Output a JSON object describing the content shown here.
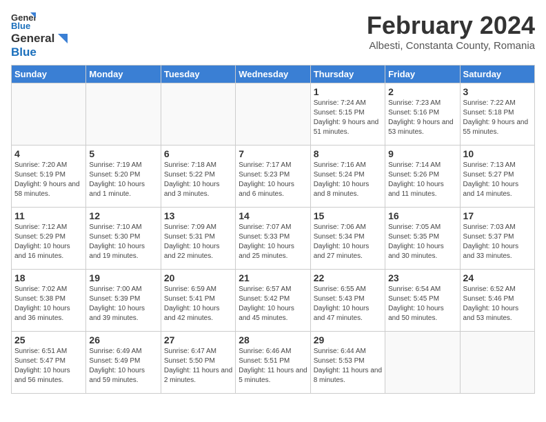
{
  "header": {
    "logo_general": "General",
    "logo_blue": "Blue",
    "month_title": "February 2024",
    "location": "Albesti, Constanta County, Romania"
  },
  "calendar": {
    "days_of_week": [
      "Sunday",
      "Monday",
      "Tuesday",
      "Wednesday",
      "Thursday",
      "Friday",
      "Saturday"
    ],
    "weeks": [
      [
        {
          "day": "",
          "info": ""
        },
        {
          "day": "",
          "info": ""
        },
        {
          "day": "",
          "info": ""
        },
        {
          "day": "",
          "info": ""
        },
        {
          "day": "1",
          "info": "Sunrise: 7:24 AM\nSunset: 5:15 PM\nDaylight: 9 hours\nand 51 minutes."
        },
        {
          "day": "2",
          "info": "Sunrise: 7:23 AM\nSunset: 5:16 PM\nDaylight: 9 hours\nand 53 minutes."
        },
        {
          "day": "3",
          "info": "Sunrise: 7:22 AM\nSunset: 5:18 PM\nDaylight: 9 hours\nand 55 minutes."
        }
      ],
      [
        {
          "day": "4",
          "info": "Sunrise: 7:20 AM\nSunset: 5:19 PM\nDaylight: 9 hours\nand 58 minutes."
        },
        {
          "day": "5",
          "info": "Sunrise: 7:19 AM\nSunset: 5:20 PM\nDaylight: 10 hours\nand 1 minute."
        },
        {
          "day": "6",
          "info": "Sunrise: 7:18 AM\nSunset: 5:22 PM\nDaylight: 10 hours\nand 3 minutes."
        },
        {
          "day": "7",
          "info": "Sunrise: 7:17 AM\nSunset: 5:23 PM\nDaylight: 10 hours\nand 6 minutes."
        },
        {
          "day": "8",
          "info": "Sunrise: 7:16 AM\nSunset: 5:24 PM\nDaylight: 10 hours\nand 8 minutes."
        },
        {
          "day": "9",
          "info": "Sunrise: 7:14 AM\nSunset: 5:26 PM\nDaylight: 10 hours\nand 11 minutes."
        },
        {
          "day": "10",
          "info": "Sunrise: 7:13 AM\nSunset: 5:27 PM\nDaylight: 10 hours\nand 14 minutes."
        }
      ],
      [
        {
          "day": "11",
          "info": "Sunrise: 7:12 AM\nSunset: 5:29 PM\nDaylight: 10 hours\nand 16 minutes."
        },
        {
          "day": "12",
          "info": "Sunrise: 7:10 AM\nSunset: 5:30 PM\nDaylight: 10 hours\nand 19 minutes."
        },
        {
          "day": "13",
          "info": "Sunrise: 7:09 AM\nSunset: 5:31 PM\nDaylight: 10 hours\nand 22 minutes."
        },
        {
          "day": "14",
          "info": "Sunrise: 7:07 AM\nSunset: 5:33 PM\nDaylight: 10 hours\nand 25 minutes."
        },
        {
          "day": "15",
          "info": "Sunrise: 7:06 AM\nSunset: 5:34 PM\nDaylight: 10 hours\nand 27 minutes."
        },
        {
          "day": "16",
          "info": "Sunrise: 7:05 AM\nSunset: 5:35 PM\nDaylight: 10 hours\nand 30 minutes."
        },
        {
          "day": "17",
          "info": "Sunrise: 7:03 AM\nSunset: 5:37 PM\nDaylight: 10 hours\nand 33 minutes."
        }
      ],
      [
        {
          "day": "18",
          "info": "Sunrise: 7:02 AM\nSunset: 5:38 PM\nDaylight: 10 hours\nand 36 minutes."
        },
        {
          "day": "19",
          "info": "Sunrise: 7:00 AM\nSunset: 5:39 PM\nDaylight: 10 hours\nand 39 minutes."
        },
        {
          "day": "20",
          "info": "Sunrise: 6:59 AM\nSunset: 5:41 PM\nDaylight: 10 hours\nand 42 minutes."
        },
        {
          "day": "21",
          "info": "Sunrise: 6:57 AM\nSunset: 5:42 PM\nDaylight: 10 hours\nand 45 minutes."
        },
        {
          "day": "22",
          "info": "Sunrise: 6:55 AM\nSunset: 5:43 PM\nDaylight: 10 hours\nand 47 minutes."
        },
        {
          "day": "23",
          "info": "Sunrise: 6:54 AM\nSunset: 5:45 PM\nDaylight: 10 hours\nand 50 minutes."
        },
        {
          "day": "24",
          "info": "Sunrise: 6:52 AM\nSunset: 5:46 PM\nDaylight: 10 hours\nand 53 minutes."
        }
      ],
      [
        {
          "day": "25",
          "info": "Sunrise: 6:51 AM\nSunset: 5:47 PM\nDaylight: 10 hours\nand 56 minutes."
        },
        {
          "day": "26",
          "info": "Sunrise: 6:49 AM\nSunset: 5:49 PM\nDaylight: 10 hours\nand 59 minutes."
        },
        {
          "day": "27",
          "info": "Sunrise: 6:47 AM\nSunset: 5:50 PM\nDaylight: 11 hours\nand 2 minutes."
        },
        {
          "day": "28",
          "info": "Sunrise: 6:46 AM\nSunset: 5:51 PM\nDaylight: 11 hours\nand 5 minutes."
        },
        {
          "day": "29",
          "info": "Sunrise: 6:44 AM\nSunset: 5:53 PM\nDaylight: 11 hours\nand 8 minutes."
        },
        {
          "day": "",
          "info": ""
        },
        {
          "day": "",
          "info": ""
        }
      ]
    ]
  }
}
